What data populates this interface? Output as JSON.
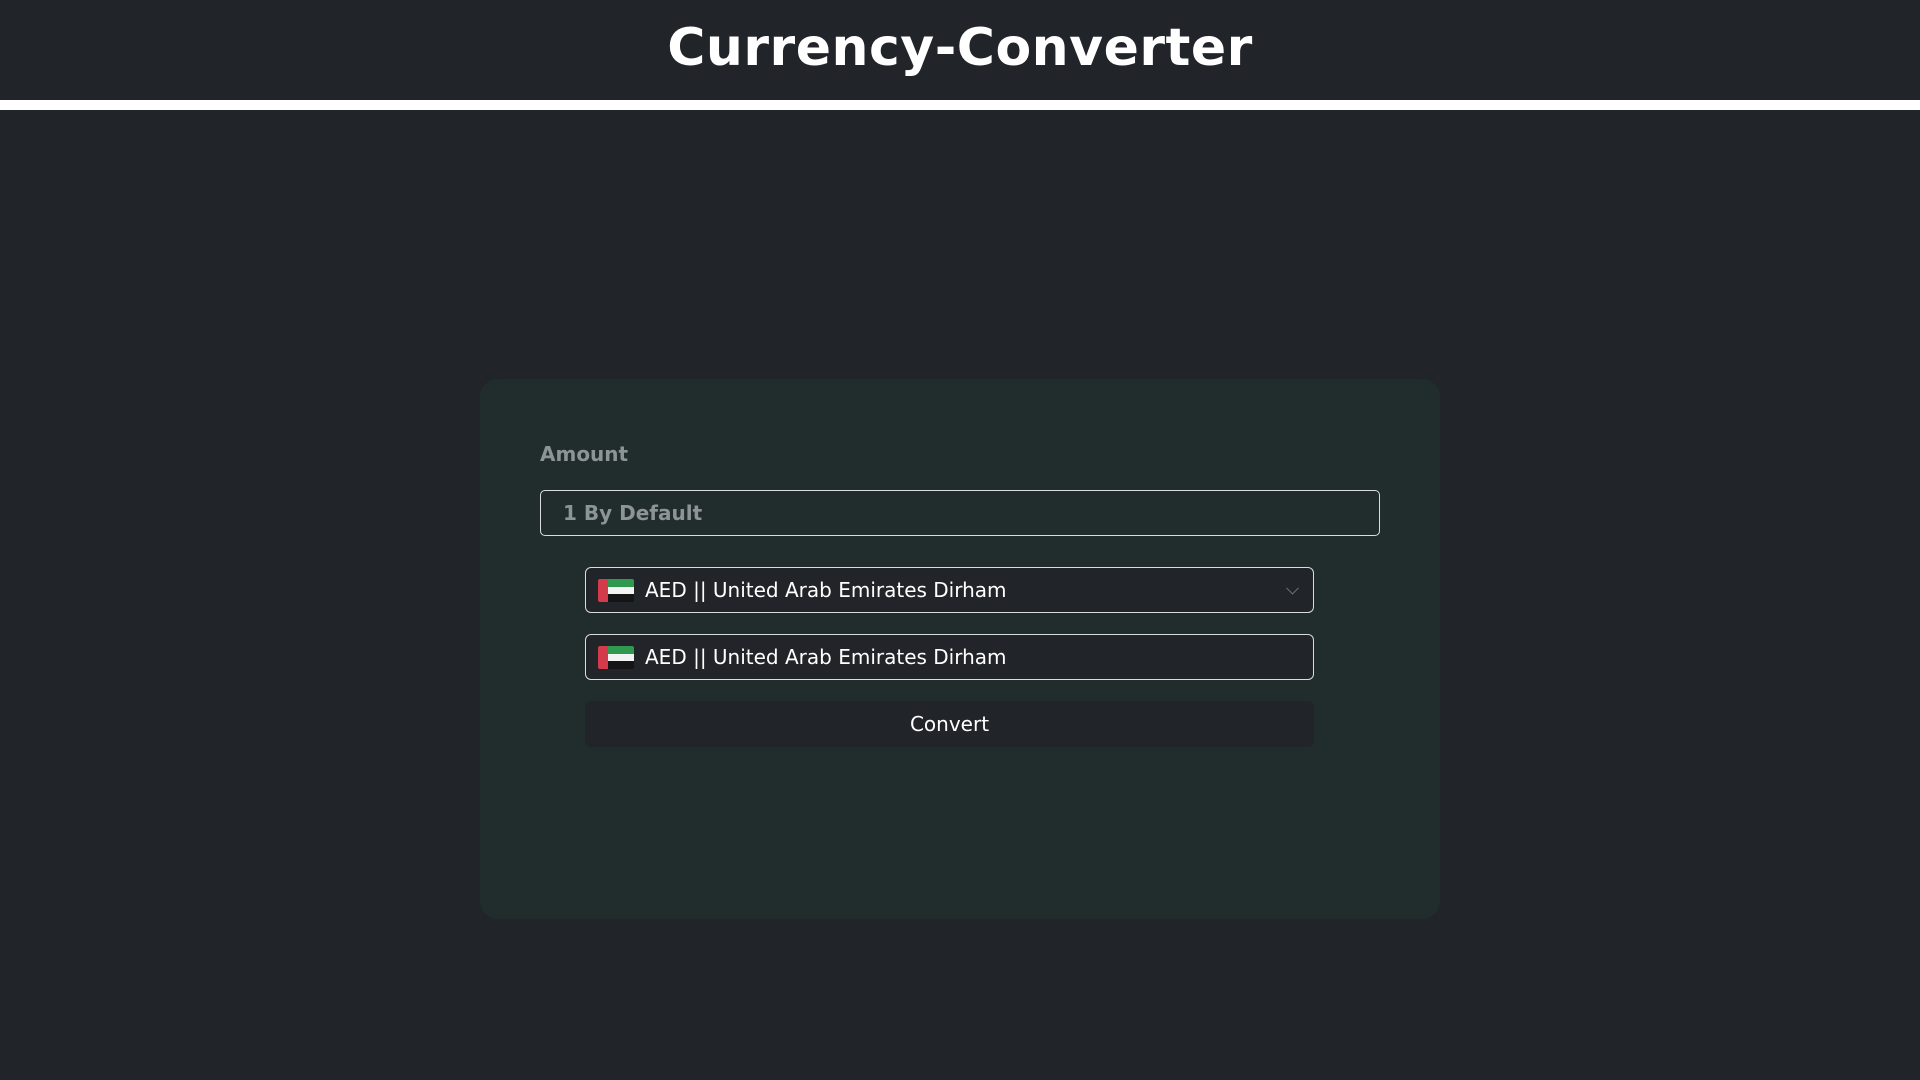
{
  "header": {
    "title": "Currency-Converter"
  },
  "form": {
    "amount_label": "Amount",
    "amount_placeholder": "1 By Default",
    "amount_value": "",
    "from_currency": {
      "label": "AED || United Arab Emirates Dirham",
      "flag_icon": "uae-flag-icon"
    },
    "to_currency": {
      "label": "AED || United Arab Emirates Dirham",
      "flag_icon": "uae-flag-icon"
    },
    "convert_label": "Convert"
  },
  "colors": {
    "page_background": "#212429",
    "card_background": "#212d2d",
    "border": "#d9dddd",
    "muted_text": "#8d9494",
    "text": "#ffffff",
    "flag_red": "#d33a4a",
    "flag_green": "#2f9a4f",
    "flag_white": "#f3f3f3",
    "flag_black": "#151515"
  }
}
